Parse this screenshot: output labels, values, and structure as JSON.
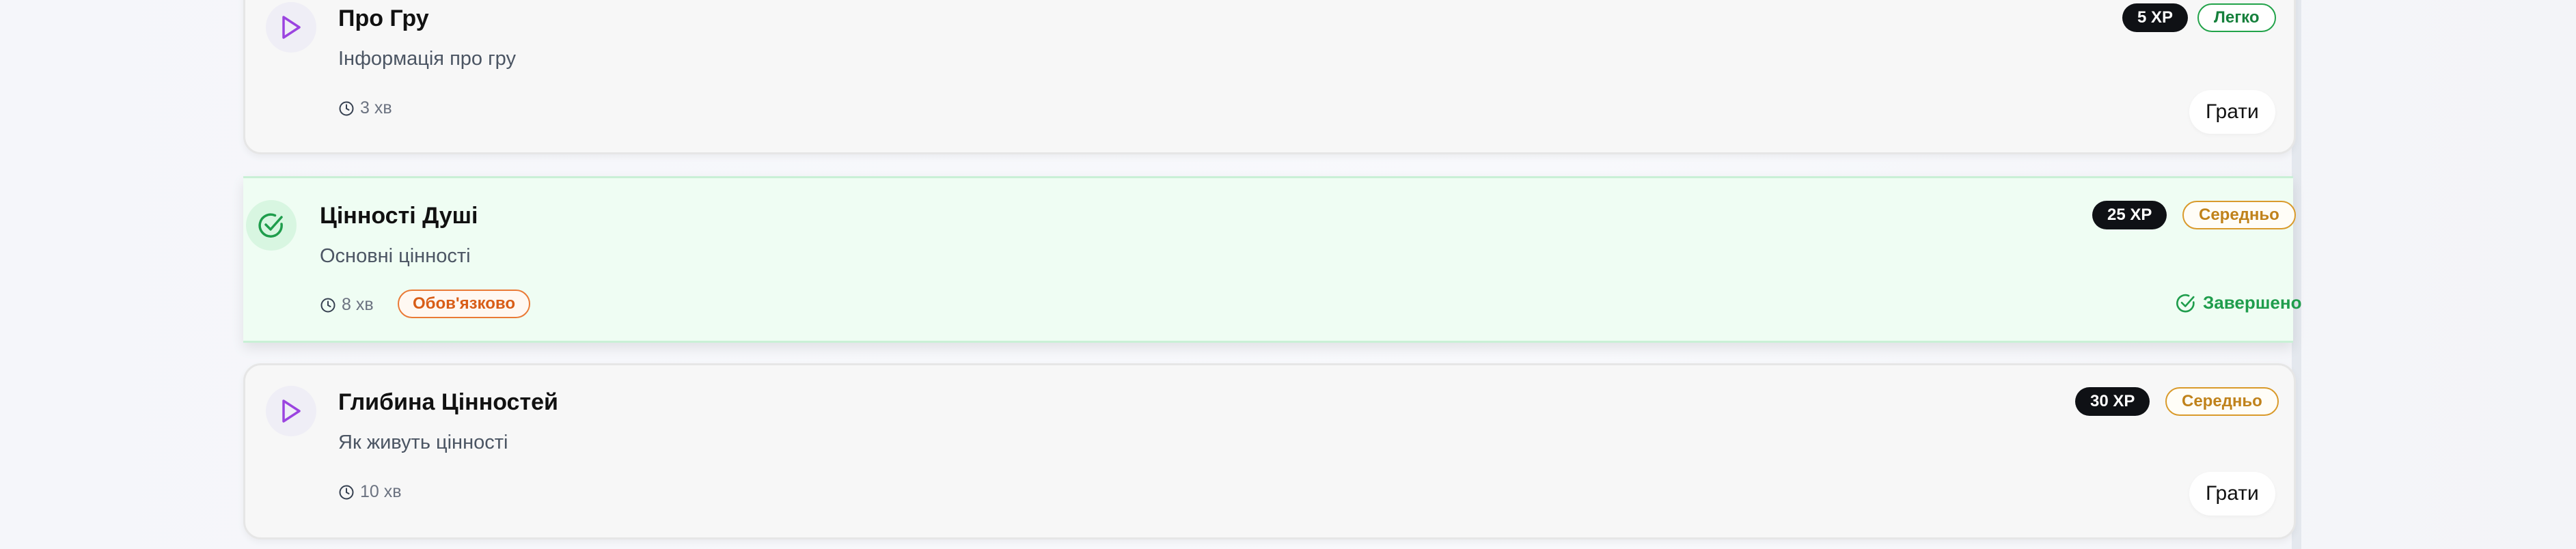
{
  "colors": {
    "accent_purple": "#9b44e0",
    "success_green": "#1f9d4c",
    "warning_orange": "#d99a2b",
    "required_orange": "#ea7a36"
  },
  "lessons": [
    {
      "title": "Про Гру",
      "description": "Інформація про гру",
      "duration": "3 хв",
      "xp": "5 XP",
      "level": "Легко",
      "action": "Грати",
      "icon": "play-icon"
    },
    {
      "title": "Цінності Душі",
      "description": "Основні цінності",
      "duration": "8 хв",
      "required": "Обов'язково",
      "xp": "25 XP",
      "level": "Середньо",
      "status": "Завершено",
      "icon": "check-circle-icon"
    },
    {
      "title": "Глибина Цінностей",
      "description": "Як живуть цінності",
      "duration": "10 хв",
      "xp": "30 XP",
      "level": "Середньо",
      "action": "Грати",
      "icon": "play-icon"
    }
  ]
}
